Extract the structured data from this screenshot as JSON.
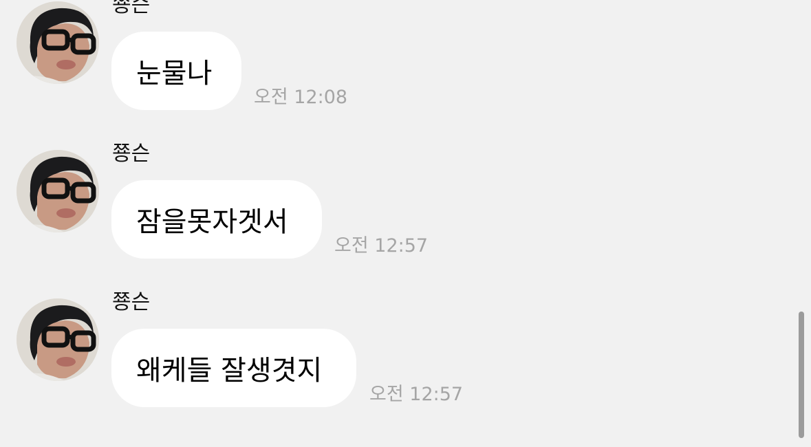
{
  "messages": [
    {
      "sender": "쭁슨",
      "text": "눈물나",
      "time": "오전 12:08"
    },
    {
      "sender": "쭁슨",
      "text": "잠을못자겟서",
      "time": "오전 12:57"
    },
    {
      "sender": "쭁슨",
      "text": "왜케들 잘생겻지",
      "time": "오전 12:57"
    }
  ],
  "colors": {
    "background": "#f1f1f1",
    "bubble": "#ffffff",
    "timestamp": "#a5a5a5"
  },
  "icons": {
    "avatar": "profile-photo"
  }
}
